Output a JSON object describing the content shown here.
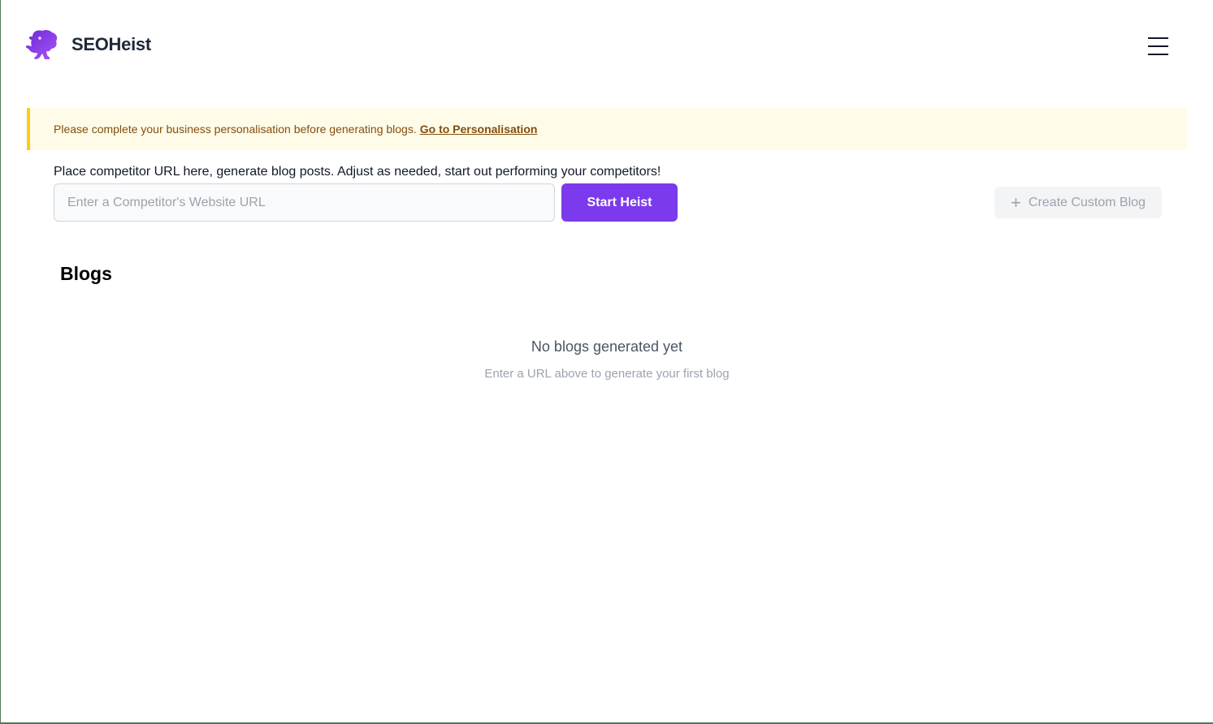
{
  "header": {
    "brand_name": "SEOHeist",
    "logo_icon": "heist-mascot-icon",
    "menu_icon": "hamburger-menu-icon"
  },
  "alert": {
    "message": "Please complete your business personalisation before generating blogs.",
    "link_label": "Go to Personalisation"
  },
  "heist": {
    "instructions": "Place competitor URL here, generate blog posts. Adjust as needed, start out performing your competitors!",
    "url_value": "",
    "url_placeholder": "Enter a Competitor's Website URL",
    "start_label": "Start Heist",
    "custom_label": "Create Custom Blog",
    "custom_icon": "plus-icon"
  },
  "blogs": {
    "title": "Blogs",
    "empty_title": "No blogs generated yet",
    "empty_subtitle": "Enter a URL above to generate your first blog"
  },
  "colors": {
    "accent": "#7c3aed",
    "alert_background": "#fefce8",
    "alert_border": "#facc15",
    "alert_text": "#854d0e"
  }
}
